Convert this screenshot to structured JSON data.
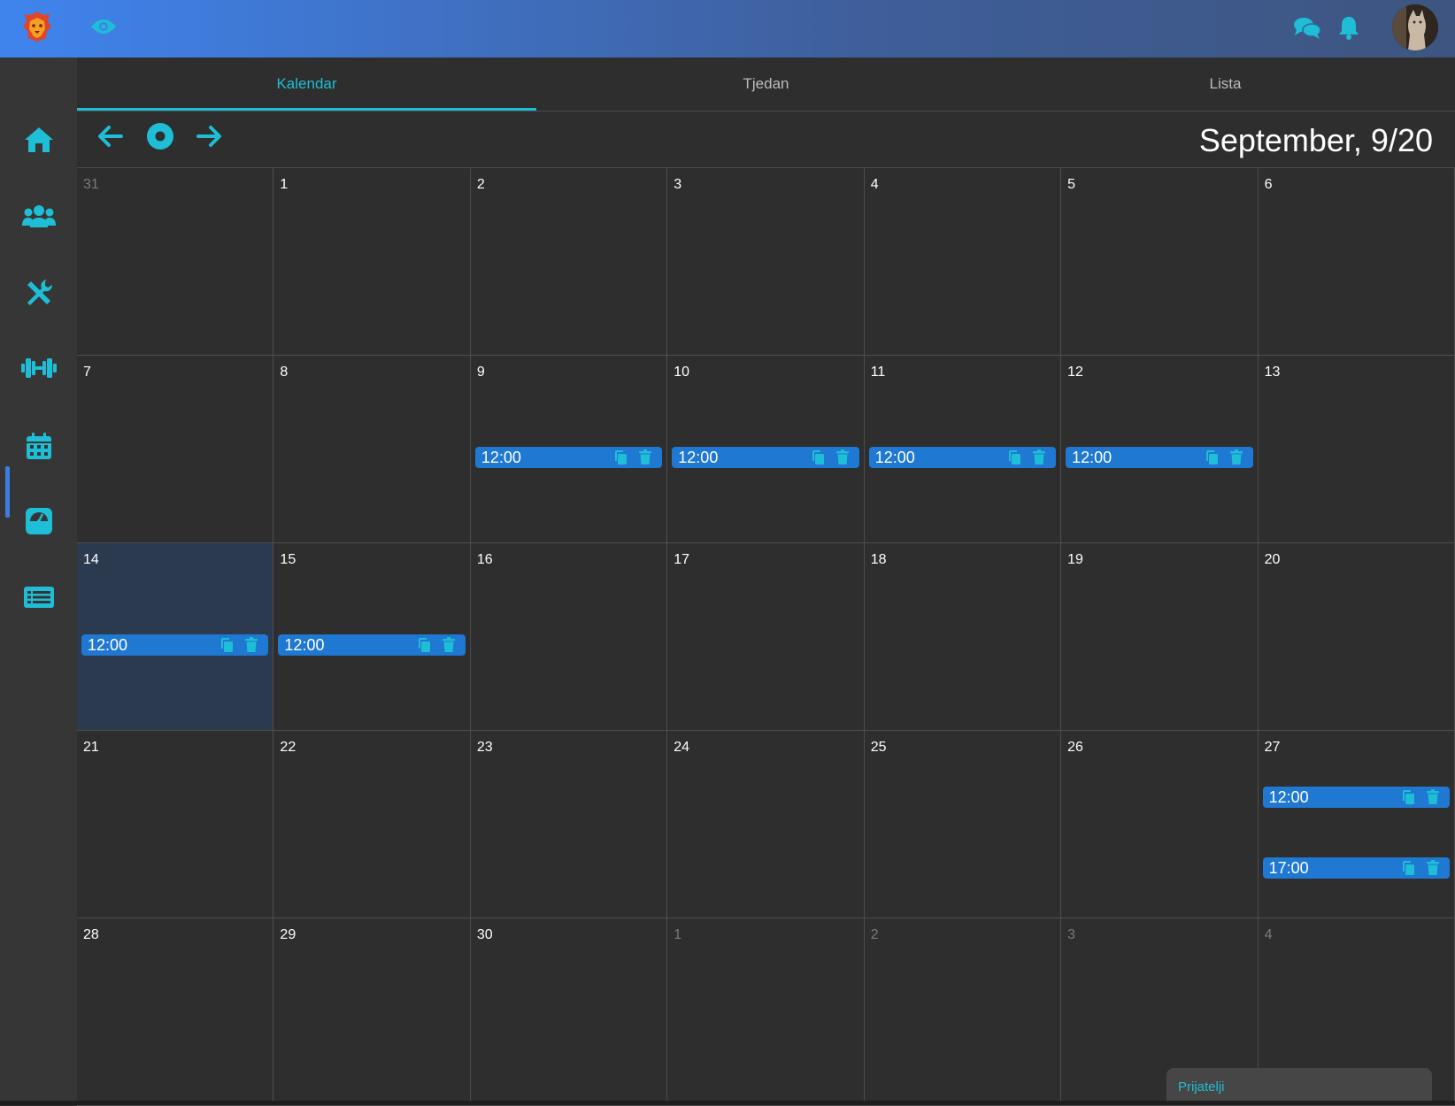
{
  "topbar": {
    "logo_icon": "lion-logo-icon",
    "view_icon": "eye-icon",
    "chat_icon": "chat-bubbles-icon",
    "bell_icon": "bell-icon",
    "avatar": "user-avatar"
  },
  "sidebar": {
    "items": [
      {
        "name": "home",
        "icon": "home-icon"
      },
      {
        "name": "users",
        "icon": "users-icon"
      },
      {
        "name": "tools",
        "icon": "tools-icon"
      },
      {
        "name": "workouts",
        "icon": "dumbbell-icon"
      },
      {
        "name": "calendar",
        "icon": "calendar-icon",
        "active": true
      },
      {
        "name": "measurements",
        "icon": "scale-icon"
      },
      {
        "name": "list",
        "icon": "list-icon"
      }
    ]
  },
  "tabs": [
    {
      "label": "Kalendar",
      "active": true
    },
    {
      "label": "Tjedan",
      "active": false
    },
    {
      "label": "Lista",
      "active": false
    }
  ],
  "toolbar": {
    "prev_icon": "arrow-left-icon",
    "today_icon": "dot-circle-icon",
    "next_icon": "arrow-right-icon",
    "title": "September, 9/20"
  },
  "calendar": {
    "weeks": [
      [
        {
          "day": "31",
          "other": true
        },
        {
          "day": "1"
        },
        {
          "day": "2"
        },
        {
          "day": "3"
        },
        {
          "day": "4"
        },
        {
          "day": "5"
        },
        {
          "day": "6"
        }
      ],
      [
        {
          "day": "7"
        },
        {
          "day": "8"
        },
        {
          "day": "9",
          "events": [
            "12:00"
          ]
        },
        {
          "day": "10",
          "events": [
            "12:00"
          ]
        },
        {
          "day": "11",
          "events": [
            "12:00"
          ]
        },
        {
          "day": "12",
          "events": [
            "12:00"
          ]
        },
        {
          "day": "13"
        }
      ],
      [
        {
          "day": "14",
          "today": true,
          "events": [
            "12:00"
          ]
        },
        {
          "day": "15",
          "events": [
            "12:00"
          ]
        },
        {
          "day": "16"
        },
        {
          "day": "17"
        },
        {
          "day": "18"
        },
        {
          "day": "19"
        },
        {
          "day": "20"
        }
      ],
      [
        {
          "day": "21"
        },
        {
          "day": "22"
        },
        {
          "day": "23"
        },
        {
          "day": "24"
        },
        {
          "day": "25"
        },
        {
          "day": "26"
        },
        {
          "day": "27",
          "events": [
            "12:00",
            "17:00"
          ]
        }
      ],
      [
        {
          "day": "28"
        },
        {
          "day": "29"
        },
        {
          "day": "30"
        },
        {
          "day": "1",
          "other": true
        },
        {
          "day": "2",
          "other": true
        },
        {
          "day": "3",
          "other": true
        },
        {
          "day": "4",
          "other": true
        }
      ]
    ],
    "event_icons": {
      "copy": "copy-icon",
      "delete": "trash-icon"
    }
  },
  "friends_panel": {
    "label": "Prijatelji"
  },
  "colors": {
    "accent": "#1ebed6",
    "event_bg": "#1f78d1",
    "today_bg": "#2b3a4e"
  }
}
